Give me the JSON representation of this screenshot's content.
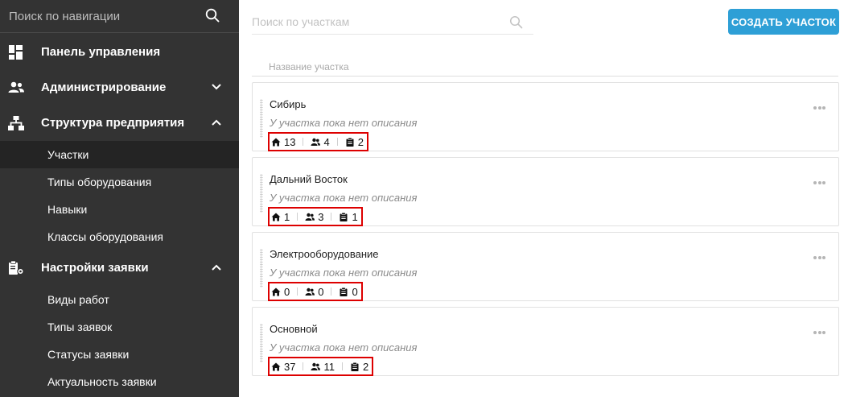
{
  "sidebar": {
    "search_placeholder": "Поиск по навигации",
    "sections": [
      {
        "label": "Панель управления",
        "icon": "dashboard-icon"
      },
      {
        "label": "Администрирование",
        "icon": "users-icon",
        "chevron": "chevron-down-icon"
      },
      {
        "label": "Структура предприятия",
        "icon": "sitemap-icon",
        "chevron": "chevron-up-icon",
        "items": [
          {
            "label": "Участки",
            "active": true
          },
          {
            "label": "Типы оборудования"
          },
          {
            "label": "Навыки"
          },
          {
            "label": "Классы оборудования"
          }
        ]
      },
      {
        "label": "Настройки заявки",
        "icon": "clipboard-gear-icon",
        "chevron": "chevron-up-icon",
        "items": [
          {
            "label": "Виды работ"
          },
          {
            "label": "Типы заявок"
          },
          {
            "label": "Статусы заявки"
          },
          {
            "label": "Актуальность заявки"
          }
        ]
      }
    ]
  },
  "main": {
    "search_placeholder": "Поиск по участкам",
    "create_button": "СОЗДАТЬ УЧАСТОК",
    "column_header": "Название участка",
    "cards": [
      {
        "title": "Сибирь",
        "description": "У участка пока нет описания",
        "homes": "13",
        "users": "4",
        "tasks": "2"
      },
      {
        "title": "Дальний Восток",
        "description": "У участка пока нет описания",
        "homes": "1",
        "users": "3",
        "tasks": "1"
      },
      {
        "title": "Электрооборудование",
        "description": "У участка пока нет описания",
        "homes": "0",
        "users": "0",
        "tasks": "0"
      },
      {
        "title": "Основной",
        "description": "У участка пока нет описания",
        "homes": "37",
        "users": "11",
        "tasks": "2"
      }
    ]
  },
  "colors": {
    "sidebar_bg": "#333333",
    "sidebar_active_bg": "#242424",
    "accent": "#2e9fd6",
    "highlight_border": "#dd0000"
  }
}
